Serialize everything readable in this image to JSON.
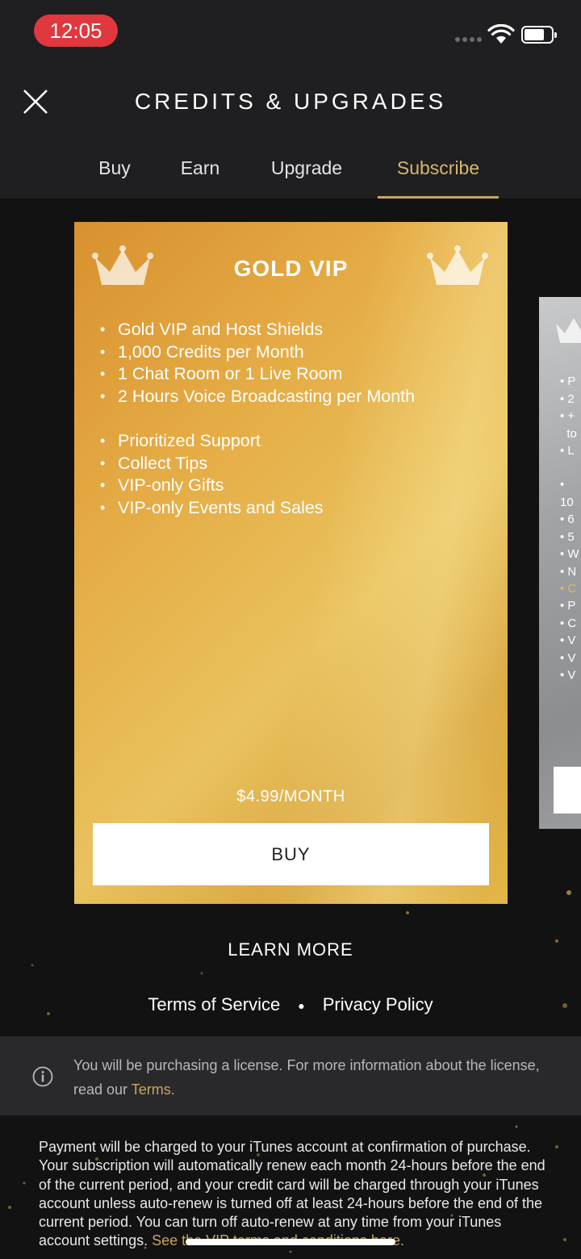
{
  "status_bar": {
    "time": "12:05"
  },
  "header": {
    "title": "CREDITS & UPGRADES",
    "tabs": [
      {
        "label": "Buy"
      },
      {
        "label": "Earn"
      },
      {
        "label": "Upgrade"
      },
      {
        "label": "Subscribe",
        "active": true
      }
    ]
  },
  "gold_card": {
    "title": "GOLD VIP",
    "features_group1": [
      "Gold VIP and Host Shields",
      "1,000 Credits per Month",
      "1 Chat Room or 1 Live Room",
      "2 Hours Voice Broadcasting per Month"
    ],
    "features_group2": [
      "Prioritized Support",
      "Collect Tips",
      "VIP-only Gifts",
      "VIP-only Events and Sales"
    ],
    "price": "$4.99/MONTH",
    "buy_label": "BUY"
  },
  "next_card_peek": {
    "bullets_group1": [
      "P",
      "2",
      "+",
      "to",
      "L"
    ],
    "bullets_group2": [
      "10",
      "6",
      "5",
      "W",
      "N",
      "C"
    ],
    "bullets_group3": [
      "P",
      "C",
      "V",
      "V",
      "V"
    ]
  },
  "learn_more": "LEARN MORE",
  "legal_links": {
    "terms": "Terms of Service",
    "privacy": "Privacy Policy"
  },
  "info": {
    "text": "You will be purchasing a license. For more information about the license, read our ",
    "link": "Terms."
  },
  "payment": {
    "text": "Payment will be charged to your iTunes account at confirmation of purchase. Your subscription will automatically renew each month 24-hours before the end of the current period, and your credit card will be charged through your iTunes account unless auto-renew is turned off at least 24-hours before the end of the current period. You can turn off auto-renew at any time from your iTunes account settings. ",
    "link": "See the VIP terms and conditions here."
  },
  "colors": {
    "accent_gold": "#c9a55d",
    "background": "#121213",
    "header": "#1f1f21",
    "status_time_pill": "#e0383e"
  }
}
